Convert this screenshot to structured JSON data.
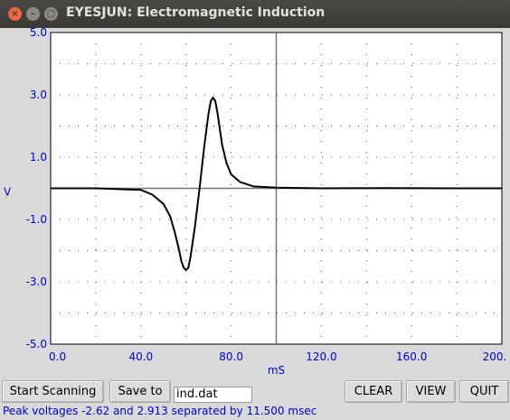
{
  "window": {
    "title": "EYESJUN: Electromagnetic Induction",
    "close_glyph": "×",
    "minimize_glyph": "–",
    "maximize_glyph": "□"
  },
  "controls": {
    "start_label": "Start Scanning",
    "save_label": "Save to",
    "filename_value": "ind.dat",
    "clear_label": "CLEAR",
    "view_label": "VIEW",
    "quit_label": "QUIT"
  },
  "status": {
    "text": "Peak voltages -2.62 and 2.913 separated by 11.500 msec"
  },
  "colors": {
    "axis_text": "#0000cc",
    "trace": "#000000",
    "plot_bg": "#ffffff",
    "window_bg": "#d9d9d9"
  },
  "chart_data": {
    "type": "line",
    "title": "",
    "xlabel": "mS",
    "ylabel": "V",
    "xlim": [
      0,
      200
    ],
    "ylim": [
      -5,
      5
    ],
    "x_ticks": [
      0,
      40,
      80,
      120,
      160,
      200
    ],
    "x_tick_labels": [
      "0.0",
      "40.0",
      "80.0",
      "120.0",
      "160.0",
      "200."
    ],
    "y_ticks": [
      5,
      3,
      1,
      -1,
      -3,
      -5
    ],
    "y_tick_labels": [
      "5.0",
      "3.0",
      "1.0",
      "-1.0",
      "-3.0",
      "-5.0"
    ],
    "grid": "dotted",
    "center_crosshair": {
      "x": 100,
      "y": 0
    },
    "series": [
      {
        "x": [
          0,
          20,
          40,
          45,
          50,
          53,
          55,
          57,
          58,
          59,
          60,
          61,
          62,
          64,
          66,
          68,
          70,
          71,
          72,
          73,
          74,
          75,
          76,
          78,
          80,
          84,
          90,
          100,
          120,
          150,
          180,
          200
        ],
        "y": [
          0,
          0,
          -0.05,
          -0.2,
          -0.5,
          -0.9,
          -1.4,
          -2.0,
          -2.35,
          -2.55,
          -2.62,
          -2.55,
          -2.2,
          -1.2,
          0.0,
          1.3,
          2.4,
          2.8,
          2.913,
          2.8,
          2.4,
          1.9,
          1.4,
          0.8,
          0.45,
          0.2,
          0.06,
          0.02,
          0,
          0.01,
          0,
          0
        ]
      }
    ]
  }
}
